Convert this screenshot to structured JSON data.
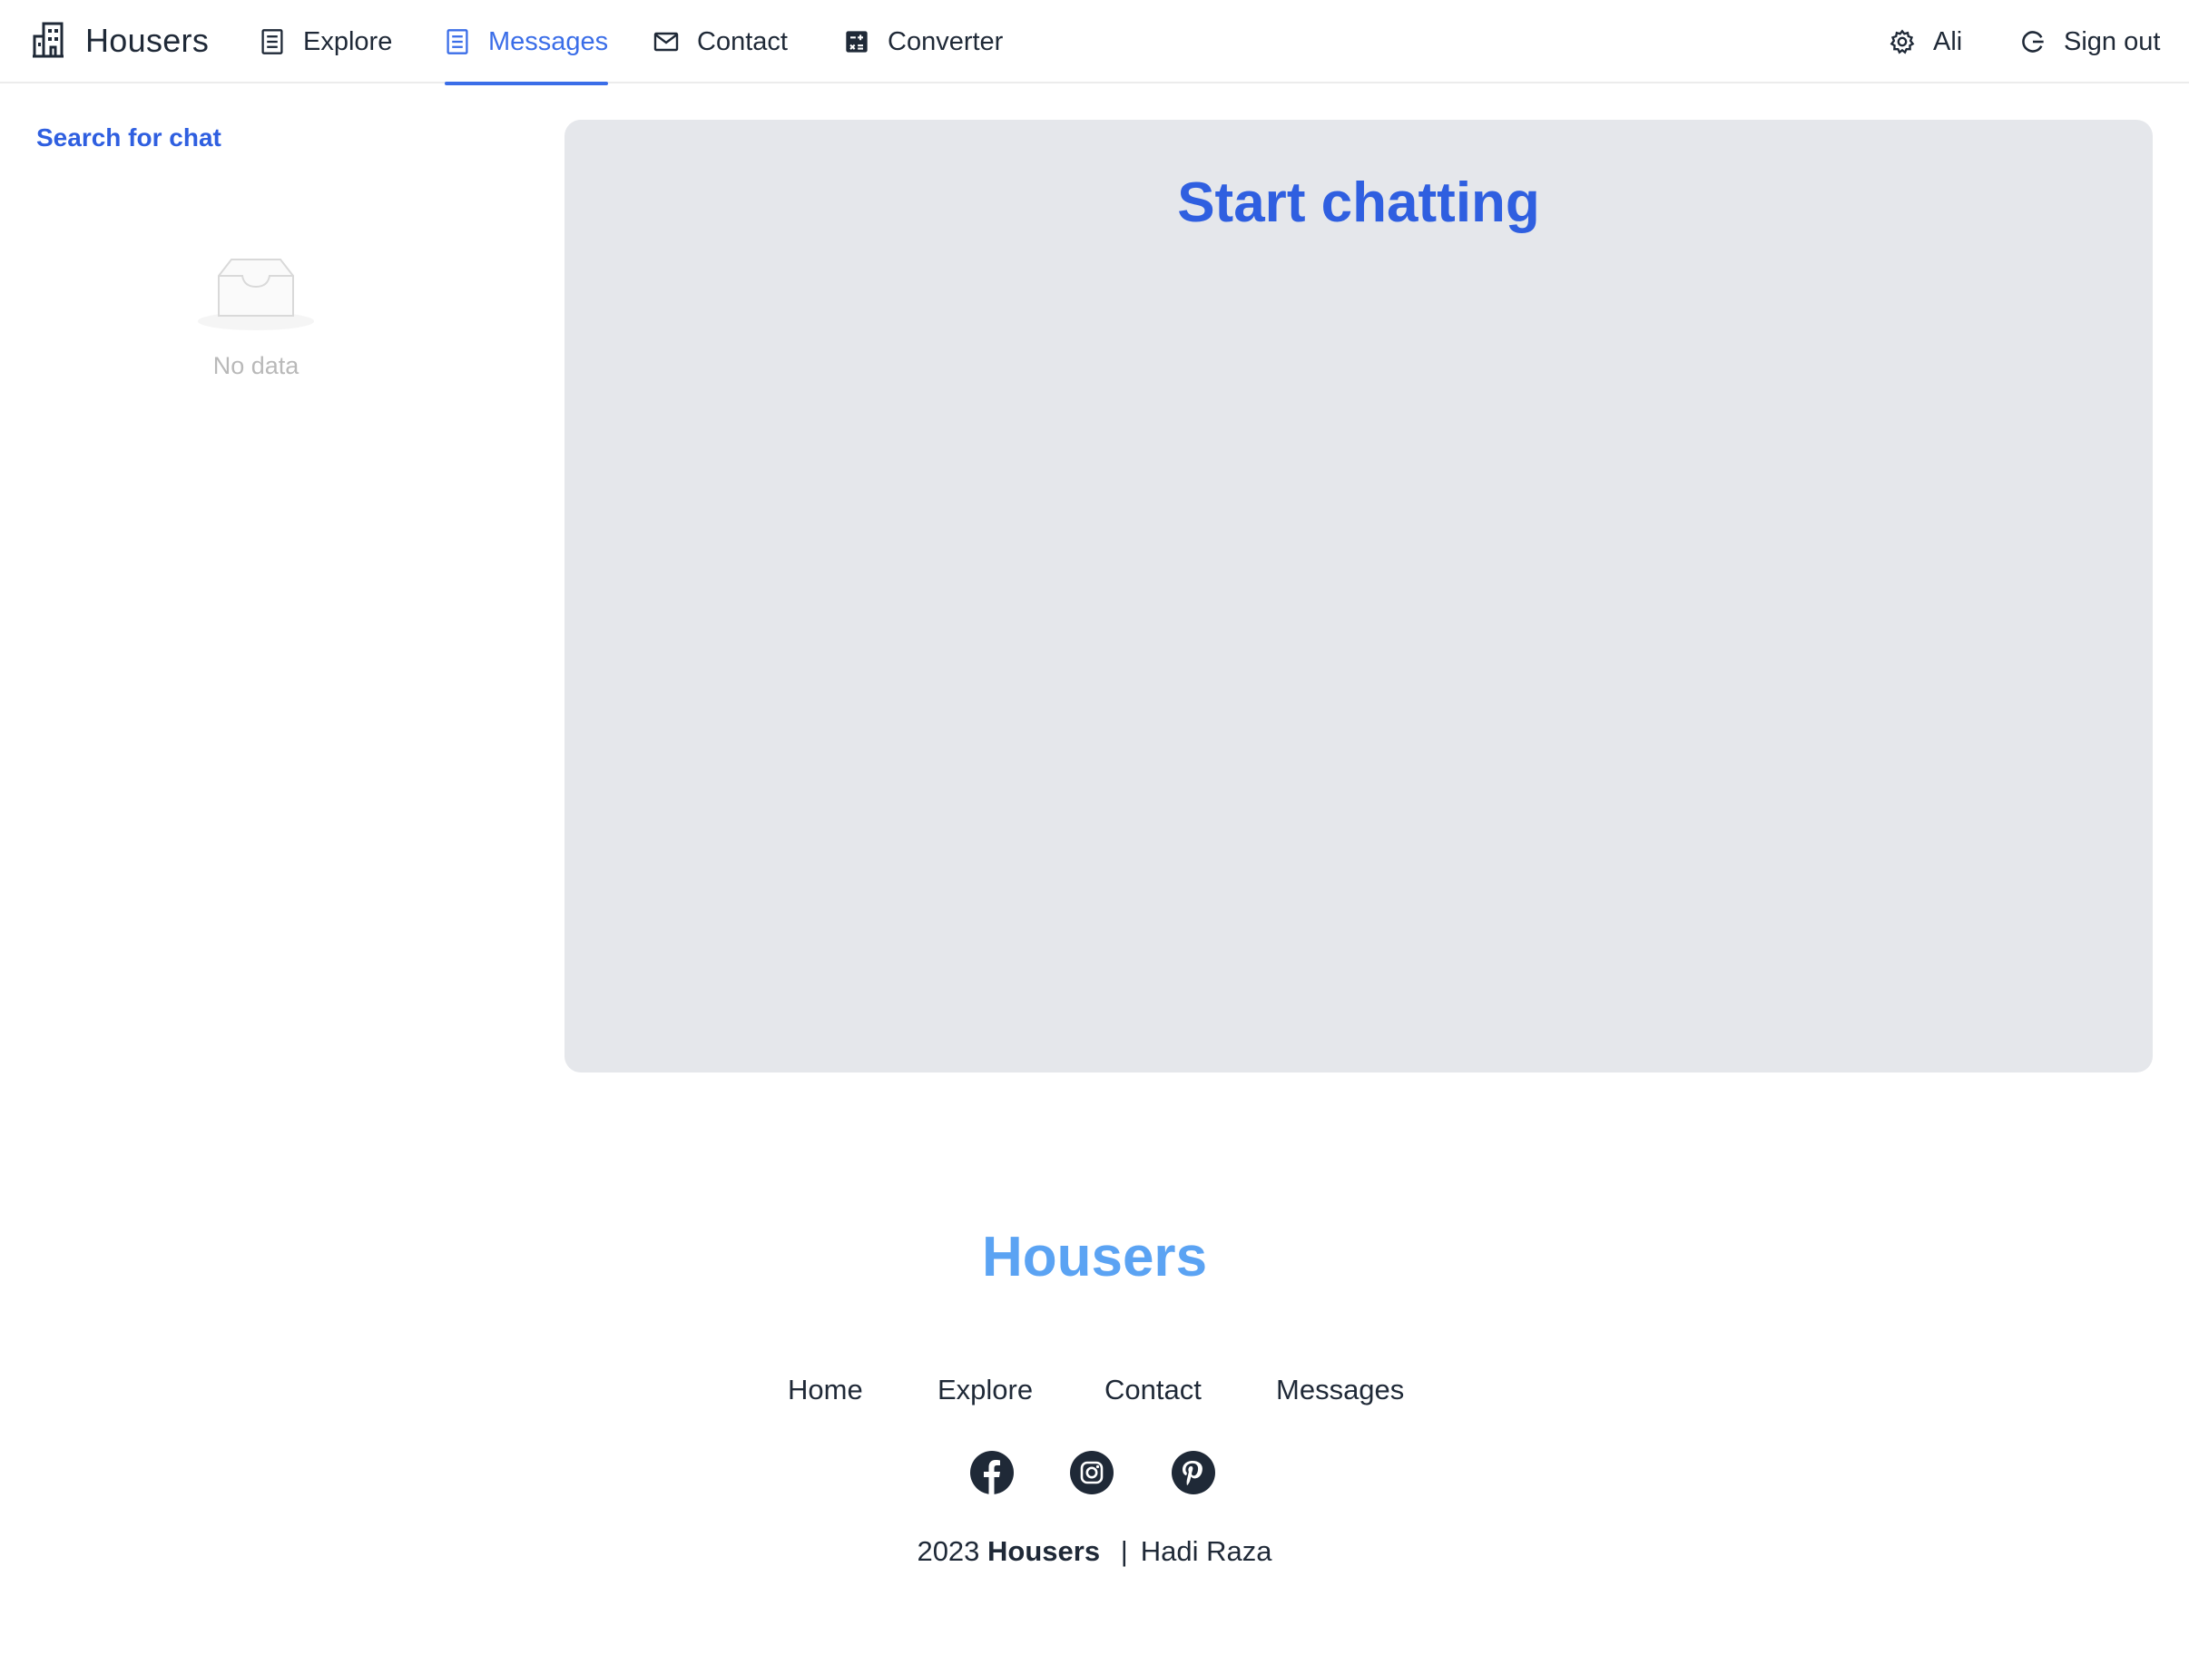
{
  "header": {
    "brand": "Housers",
    "nav": {
      "explore": "Explore",
      "messages": "Messages",
      "contact": "Contact",
      "converter": "Converter"
    },
    "active_nav": "messages",
    "user": "Ali",
    "sign_out": "Sign out"
  },
  "sidebar": {
    "search_label": "Search for chat",
    "empty_text": "No data"
  },
  "chat": {
    "title": "Start chatting"
  },
  "footer": {
    "brand": "Housers",
    "links": [
      "Home",
      "Explore",
      "Contact",
      "Messages"
    ],
    "social_icons": [
      "facebook-icon",
      "instagram-icon",
      "pinterest-icon"
    ],
    "copyright_year": "2023",
    "copyright_brand": "Housers",
    "separator": "|",
    "author": "Hadi Raza"
  },
  "colors": {
    "accent": "#3b6ee8",
    "title_blue": "#2f5fe0",
    "footer_brand": "#5ba3f3",
    "panel_bg": "#e5e7eb",
    "empty_text": "#b9b9b9"
  }
}
